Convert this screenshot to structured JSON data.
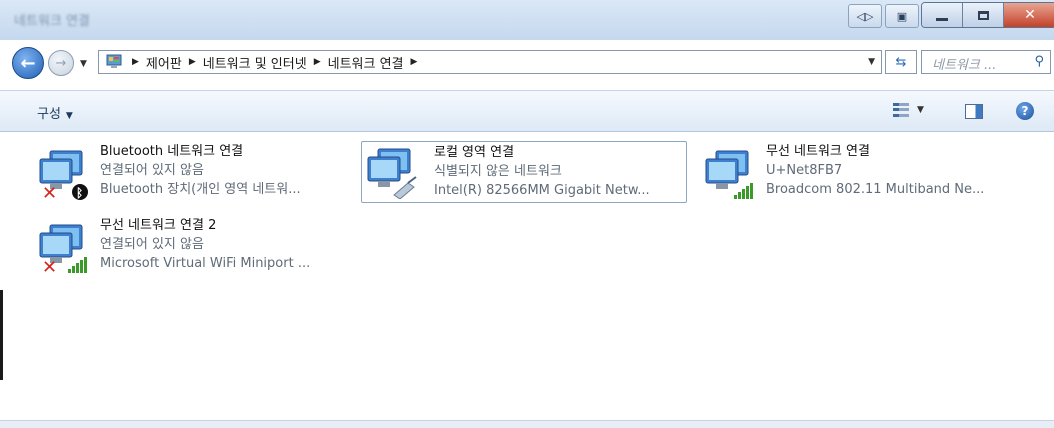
{
  "window": {
    "title": "네트워크 연결",
    "caption_buttons": [
      "minimize",
      "maximize",
      "close"
    ]
  },
  "address_bar": {
    "breadcrumbs": [
      "제어판",
      "네트워크 및 인터넷",
      "네트워크 연결"
    ],
    "search_placeholder": "네트워크 ..."
  },
  "toolbar": {
    "organize_label": "구성"
  },
  "connections": [
    {
      "name": "Bluetooth 네트워크 연결",
      "status": "연결되어 있지 않음",
      "device": "Bluetooth 장치(개인 영역 네트워...",
      "badge": "bluetooth-icon",
      "disconnected": true,
      "selected": false
    },
    {
      "name": "로컬 영역 연결",
      "status": "식별되지 않은 네트워크",
      "device": "Intel(R) 82566MM Gigabit Netw...",
      "badge": "ethernet-cable-icon",
      "disconnected": false,
      "selected": true
    },
    {
      "name": "무선 네트워크 연결",
      "status": "U+Net8FB7",
      "device": "Broadcom 802.11 Multiband Ne...",
      "badge": "signal-bars-icon",
      "disconnected": false,
      "selected": false
    },
    {
      "name": "무선 네트워크 연결 2",
      "status": "연결되어 있지 않음",
      "device": "Microsoft Virtual WiFi Miniport ...",
      "badge": "signal-bars-icon",
      "disconnected": true,
      "selected": false
    }
  ],
  "colors": {
    "titlebar": "#c4d8ee",
    "close_button": "#c3422a",
    "link_text": "#1e395b",
    "status_text": "#5f6b78"
  }
}
